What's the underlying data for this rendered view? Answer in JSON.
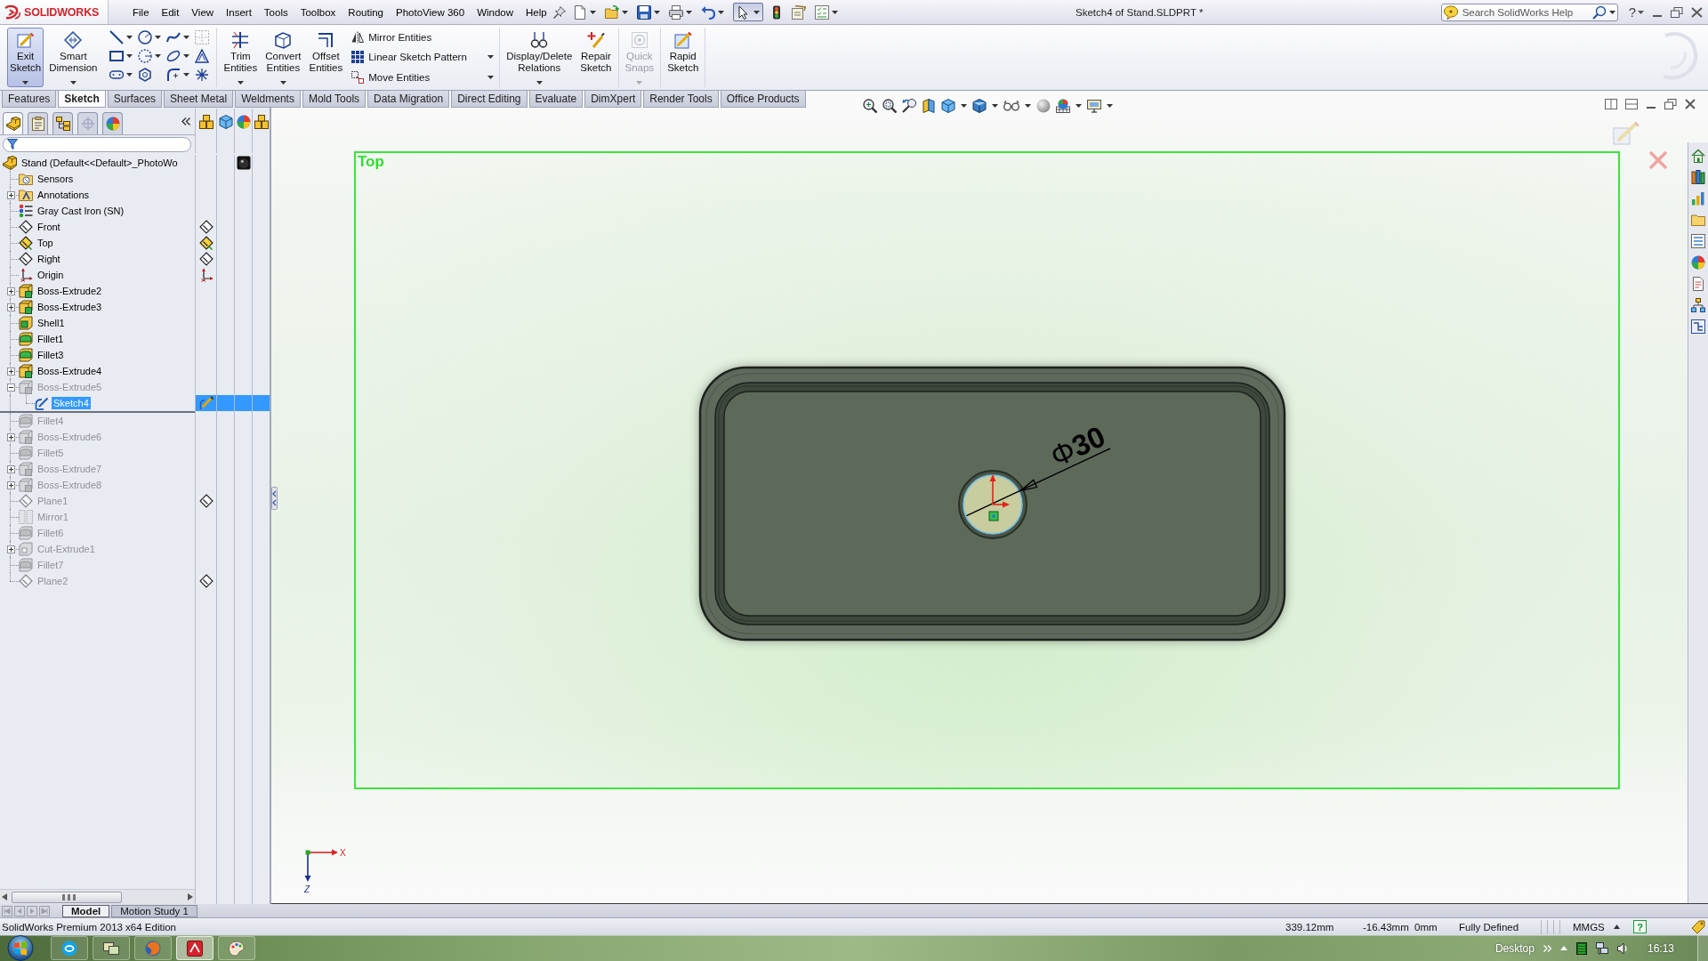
{
  "title_bar": {
    "logo": "SOLIDWORKS",
    "menu": [
      "File",
      "Edit",
      "View",
      "Insert",
      "Tools",
      "Toolbox",
      "Routing",
      "PhotoView 360",
      "Window",
      "Help"
    ],
    "select_tool_selected": true,
    "title": "Sketch4 of Stand.SLDPRT *",
    "search": {
      "placeholder": "Search SolidWorks Help"
    },
    "help": "?"
  },
  "command_manager": {
    "groups": [
      {
        "items": [
          {
            "kind": "large",
            "label": "Exit Sketch",
            "selected": true,
            "disabled": false,
            "caret": true
          },
          {
            "kind": "large",
            "label": "Smart Dimension",
            "selected": false,
            "disabled": false,
            "caret": true
          },
          {
            "kind": "tools"
          }
        ]
      },
      {
        "items": [
          {
            "kind": "large",
            "label": "Trim Entities",
            "selected": false,
            "disabled": false,
            "caret": true
          },
          {
            "kind": "large",
            "label": "Convert Entities",
            "selected": false,
            "disabled": false,
            "caret": true
          },
          {
            "kind": "large",
            "label": "Offset Entities",
            "selected": false,
            "disabled": false,
            "caret": false
          },
          {
            "kind": "stack",
            "rows": [
              {
                "label": "Mirror Entities",
                "caret": false
              },
              {
                "label": "Linear Sketch Pattern",
                "caret": true
              },
              {
                "label": "Move Entities",
                "caret": true
              }
            ]
          }
        ]
      },
      {
        "items": [
          {
            "kind": "large",
            "label": "Display/Delete Relations",
            "selected": false,
            "disabled": false,
            "caret": true
          },
          {
            "kind": "large",
            "label": "Repair Sketch",
            "selected": false,
            "disabled": false,
            "caret": false
          }
        ]
      },
      {
        "items": [
          {
            "kind": "large",
            "label": "Quick Snaps",
            "selected": false,
            "disabled": true,
            "caret": true
          }
        ]
      },
      {
        "items": [
          {
            "kind": "large",
            "label": "Rapid Sketch",
            "selected": false,
            "disabled": false,
            "caret": false
          }
        ]
      }
    ]
  },
  "tabs": [
    {
      "label": "Features",
      "selected": false
    },
    {
      "label": "Sketch",
      "selected": true
    },
    {
      "label": "Surfaces",
      "selected": false
    },
    {
      "label": "Sheet Metal",
      "selected": false
    },
    {
      "label": "Weldments",
      "selected": false
    },
    {
      "label": "Mold Tools",
      "selected": false
    },
    {
      "label": "Data Migration",
      "selected": false
    },
    {
      "label": "Direct Editing",
      "selected": false
    },
    {
      "label": "Evaluate",
      "selected": false
    },
    {
      "label": "DimXpert",
      "selected": false
    },
    {
      "label": "Render Tools",
      "selected": false
    },
    {
      "label": "Office Products",
      "selected": false
    }
  ],
  "feature_manager": {
    "tabs": [
      {
        "kind": "tree",
        "selected": true
      },
      {
        "kind": "properties",
        "selected": false
      },
      {
        "kind": "configurations",
        "selected": false
      },
      {
        "kind": "dimxpert",
        "selected": false
      },
      {
        "kind": "display",
        "selected": false
      }
    ],
    "tree": {
      "label": "Stand (Default<<Default>_PhotoWo",
      "kind": "part",
      "selected": false,
      "rolled_back": false,
      "active": false,
      "children": [
        {
          "label": "Sensors",
          "kind": "sensors",
          "selected": false,
          "rolled_back": false,
          "active": false
        },
        {
          "label": "Annotations",
          "kind": "annotations",
          "selected": false,
          "rolled_back": false,
          "active": false,
          "expanded": false
        },
        {
          "label": "Gray Cast Iron (SN)",
          "kind": "material",
          "selected": false,
          "rolled_back": false,
          "active": false
        },
        {
          "label": "Front",
          "kind": "plane",
          "selected": false,
          "rolled_back": false,
          "active": false
        },
        {
          "label": "Top",
          "kind": "plane",
          "selected": false,
          "rolled_back": false,
          "active": true
        },
        {
          "label": "Right",
          "kind": "plane",
          "selected": false,
          "rolled_back": false,
          "active": false
        },
        {
          "label": "Origin",
          "kind": "origin",
          "selected": false,
          "rolled_back": false,
          "active": false
        },
        {
          "label": "Boss-Extrude2",
          "kind": "extrude",
          "selected": false,
          "rolled_back": false,
          "active": false,
          "expanded": false
        },
        {
          "label": "Boss-Extrude3",
          "kind": "extrude",
          "selected": false,
          "rolled_back": false,
          "active": false,
          "expanded": false
        },
        {
          "label": "Shell1",
          "kind": "shell",
          "selected": false,
          "rolled_back": false,
          "active": false
        },
        {
          "label": "Fillet1",
          "kind": "fillet",
          "selected": false,
          "rolled_back": false,
          "active": false
        },
        {
          "label": "Fillet3",
          "kind": "fillet",
          "selected": false,
          "rolled_back": false,
          "active": false
        },
        {
          "label": "Boss-Extrude4",
          "kind": "extrude",
          "selected": false,
          "rolled_back": false,
          "active": false,
          "expanded": false
        },
        {
          "label": "Boss-Extrude5",
          "kind": "extrude",
          "selected": false,
          "rolled_back": true,
          "active": false,
          "expanded": true,
          "children": [
            {
              "label": "Sketch4",
              "kind": "sketch",
              "selected": true,
              "rolled_back": false,
              "active": false
            }
          ]
        },
        {
          "kind": "rollback"
        },
        {
          "label": "Fillet4",
          "kind": "fillet",
          "selected": false,
          "rolled_back": true,
          "active": false
        },
        {
          "label": "Boss-Extrude6",
          "kind": "extrude",
          "selected": false,
          "rolled_back": true,
          "active": false,
          "expanded": false
        },
        {
          "label": "Fillet5",
          "kind": "fillet",
          "selected": false,
          "rolled_back": true,
          "active": false
        },
        {
          "label": "Boss-Extrude7",
          "kind": "extrude",
          "selected": false,
          "rolled_back": true,
          "active": false,
          "expanded": false
        },
        {
          "label": "Boss-Extrude8",
          "kind": "extrude",
          "selected": false,
          "rolled_back": true,
          "active": false,
          "expanded": false
        },
        {
          "label": "Plane1",
          "kind": "plane",
          "selected": false,
          "rolled_back": true,
          "active": false
        },
        {
          "label": "Mirror1",
          "kind": "mirror",
          "selected": false,
          "rolled_back": true,
          "active": false
        },
        {
          "label": "Fillet6",
          "kind": "fillet",
          "selected": false,
          "rolled_back": true,
          "active": false
        },
        {
          "label": "Cut-Extrude1",
          "kind": "cut",
          "selected": false,
          "rolled_back": true,
          "active": false,
          "expanded": false
        },
        {
          "label": "Fillet7",
          "kind": "fillet",
          "selected": false,
          "rolled_back": true,
          "active": false
        },
        {
          "label": "Plane2",
          "kind": "plane",
          "selected": false,
          "rolled_back": true,
          "active": false
        }
      ]
    },
    "bottom_tabs": [
      {
        "label": "Model",
        "selected": true
      },
      {
        "label": "Motion Study 1",
        "selected": false
      }
    ]
  },
  "graphics": {
    "view_label": "Top",
    "dimension": "Φ**30**",
    "triad": {
      "x_label": "X",
      "z_label": "Z"
    }
  },
  "status_bar": {
    "edition": "SolidWorks Premium 2013 x64 Edition",
    "readouts": [
      "339.12mm",
      "-16.43mm",
      "0mm"
    ],
    "sketch_status": "Fully Defined",
    "units": "MMGS",
    "help": "?"
  },
  "taskbar": {
    "apps": [
      {
        "kind": "chat",
        "active": false
      },
      {
        "kind": "window",
        "active": false
      },
      {
        "kind": "browser",
        "active": false
      },
      {
        "kind": "cad",
        "active": true
      },
      {
        "kind": "paint",
        "active": false
      }
    ],
    "toolbar": "Desktop",
    "clock": "16:13"
  }
}
